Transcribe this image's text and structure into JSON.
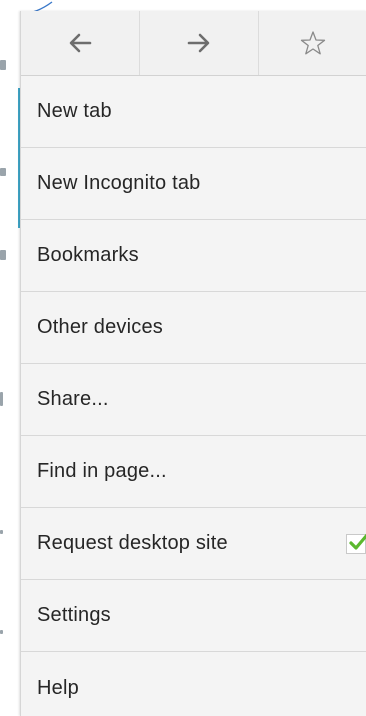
{
  "nav": {
    "back_icon": "arrow-left-icon",
    "forward_icon": "arrow-right-icon",
    "bookmark_icon": "star-outline-icon"
  },
  "menu": {
    "items": [
      {
        "label": "New tab"
      },
      {
        "label": "New Incognito tab"
      },
      {
        "label": "Bookmarks"
      },
      {
        "label": "Other devices"
      },
      {
        "label": "Share..."
      },
      {
        "label": "Find in page..."
      },
      {
        "label": "Request desktop site",
        "checked": true
      },
      {
        "label": "Settings"
      },
      {
        "label": "Help"
      }
    ]
  },
  "colors": {
    "menu_background": "#f4f4f4",
    "text": "#262626",
    "divider": "#d8d8d8",
    "check_green": "#5bb82e",
    "annotation_line": "#3a78c9"
  }
}
